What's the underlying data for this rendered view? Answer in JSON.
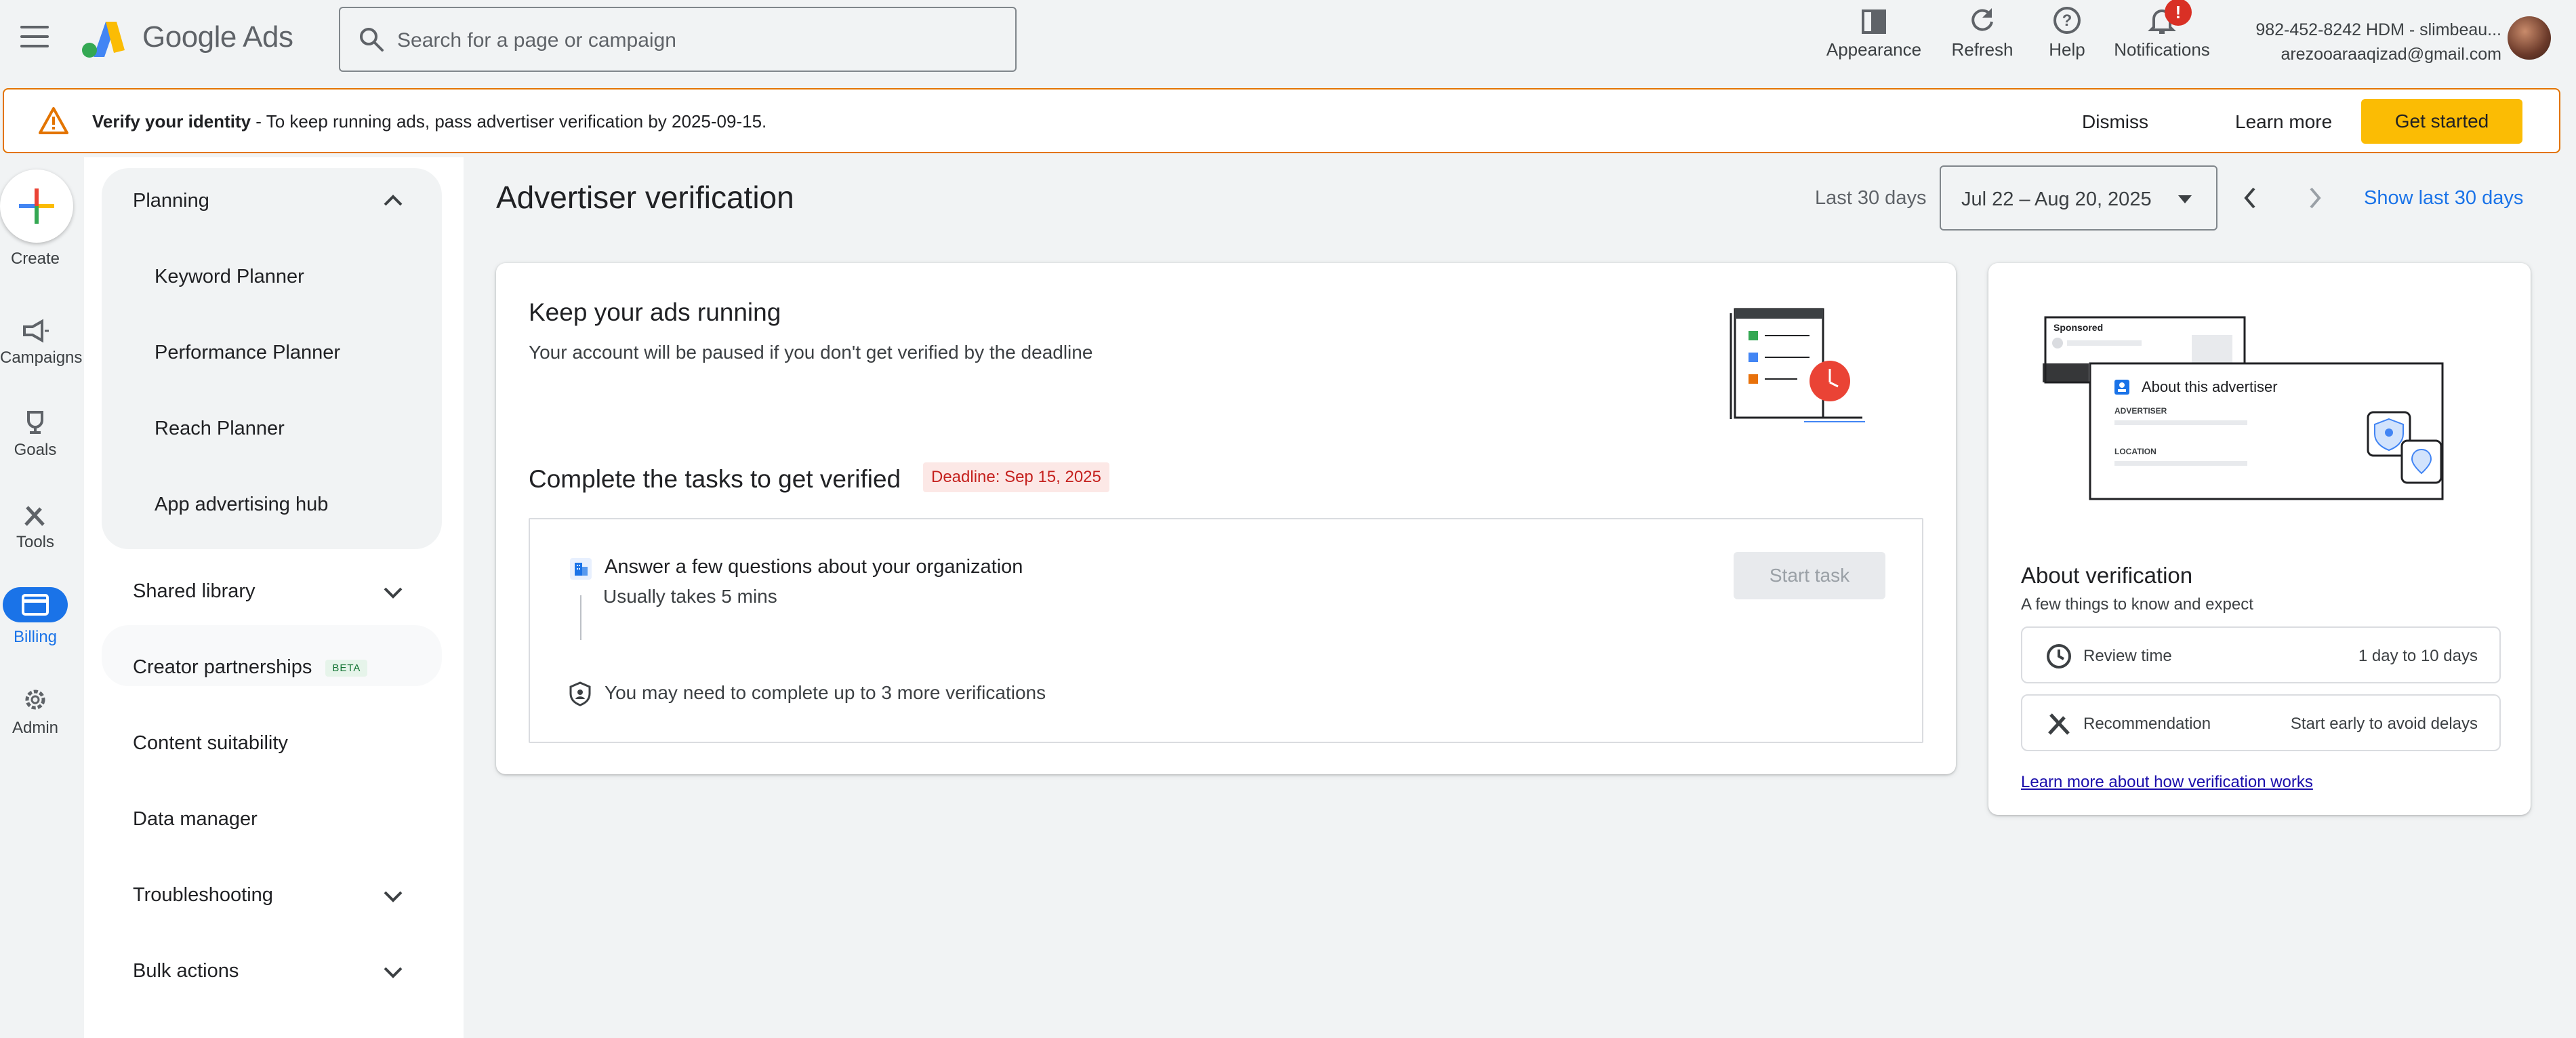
{
  "header": {
    "brand": "Google Ads",
    "search_placeholder": "Search for a page or campaign",
    "tools": [
      {
        "label": "Appearance",
        "icon": "appearance-icon"
      },
      {
        "label": "Refresh",
        "icon": "refresh-icon"
      },
      {
        "label": "Help",
        "icon": "help-icon"
      },
      {
        "label": "Notifications",
        "icon": "bell-icon",
        "badge": "!"
      }
    ],
    "account_line1": "982-452-8242 HDM - slimbeau...",
    "account_line2": "arezooaraaqizad@gmail.com"
  },
  "banner": {
    "title": "Verify your identity",
    "message": " - To keep running ads, pass advertiser verification by 2025-09-15.",
    "dismiss": "Dismiss",
    "learn_more": "Learn more",
    "get_started": "Get started"
  },
  "rail": {
    "create": "Create",
    "campaigns": "Campaigns",
    "goals": "Goals",
    "tools": "Tools",
    "billing": "Billing",
    "admin": "Admin"
  },
  "sidenav": {
    "planning": "Planning",
    "planning_items": [
      "Keyword Planner",
      "Performance Planner",
      "Reach Planner",
      "App advertising hub"
    ],
    "shared_library": "Shared library",
    "creator_partnerships": "Creator partnerships",
    "beta": "BETA",
    "content_suitability": "Content suitability",
    "data_manager": "Data manager",
    "troubleshooting": "Troubleshooting",
    "bulk_actions": "Bulk actions"
  },
  "main": {
    "title": "Advertiser verification",
    "range_label": "Last 30 days",
    "date_range": "Jul 22 – Aug 20, 2025",
    "show_last": "Show last 30 days",
    "keep_title": "Keep your ads running",
    "keep_sub": "Your account will be paused if you don't get verified by the deadline",
    "tasks_title": "Complete the tasks to get verified",
    "deadline": "Deadline: Sep 15, 2025",
    "task_title": "Answer a few questions about your organization",
    "task_sub": "Usually takes 5 mins",
    "start_task": "Start task",
    "more_verifications": "You may need to complete up to 3 more verifications"
  },
  "about": {
    "illus_sponsored": "Sponsored",
    "illus_about": "About this advertiser",
    "illus_advertiser": "ADVERTISER",
    "illus_location": "LOCATION",
    "title": "About verification",
    "subtitle": "A few things to know and expect",
    "review_label": "Review time",
    "review_value": "1 day to 10 days",
    "rec_label": "Recommendation",
    "rec_value": "Start early to avoid delays",
    "learn_link": "Learn more about how verification works"
  },
  "colors": {
    "accent": "#1a73e8",
    "warning": "#e37400",
    "cta": "#fbbc04",
    "deadline_bg": "#fce8e6",
    "deadline_text": "#c5221f"
  }
}
